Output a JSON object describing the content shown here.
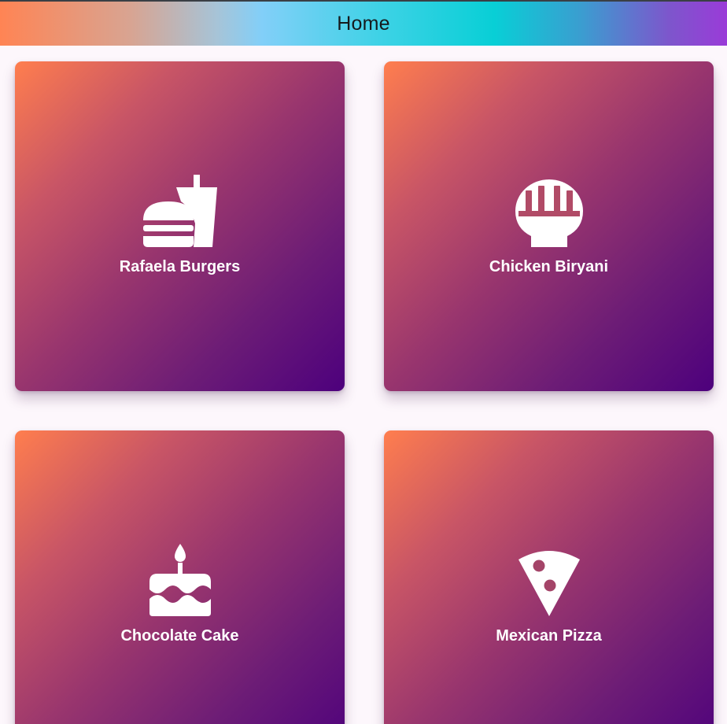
{
  "appbar": {
    "title": "Home"
  },
  "cards": [
    {
      "label": "Rafaela Burgers",
      "icon": "fastfood-icon"
    },
    {
      "label": "Chicken Biryani",
      "icon": "ramen-dining-icon"
    },
    {
      "label": "Chocolate Cake",
      "icon": "cake-icon"
    },
    {
      "label": "Mexican Pizza",
      "icon": "local-pizza-icon"
    }
  ],
  "colors": {
    "card_gradient_start": "#ff7e4e",
    "card_gradient_end": "#4d007d",
    "label": "#ffffff",
    "background": "#fdf7fc"
  }
}
